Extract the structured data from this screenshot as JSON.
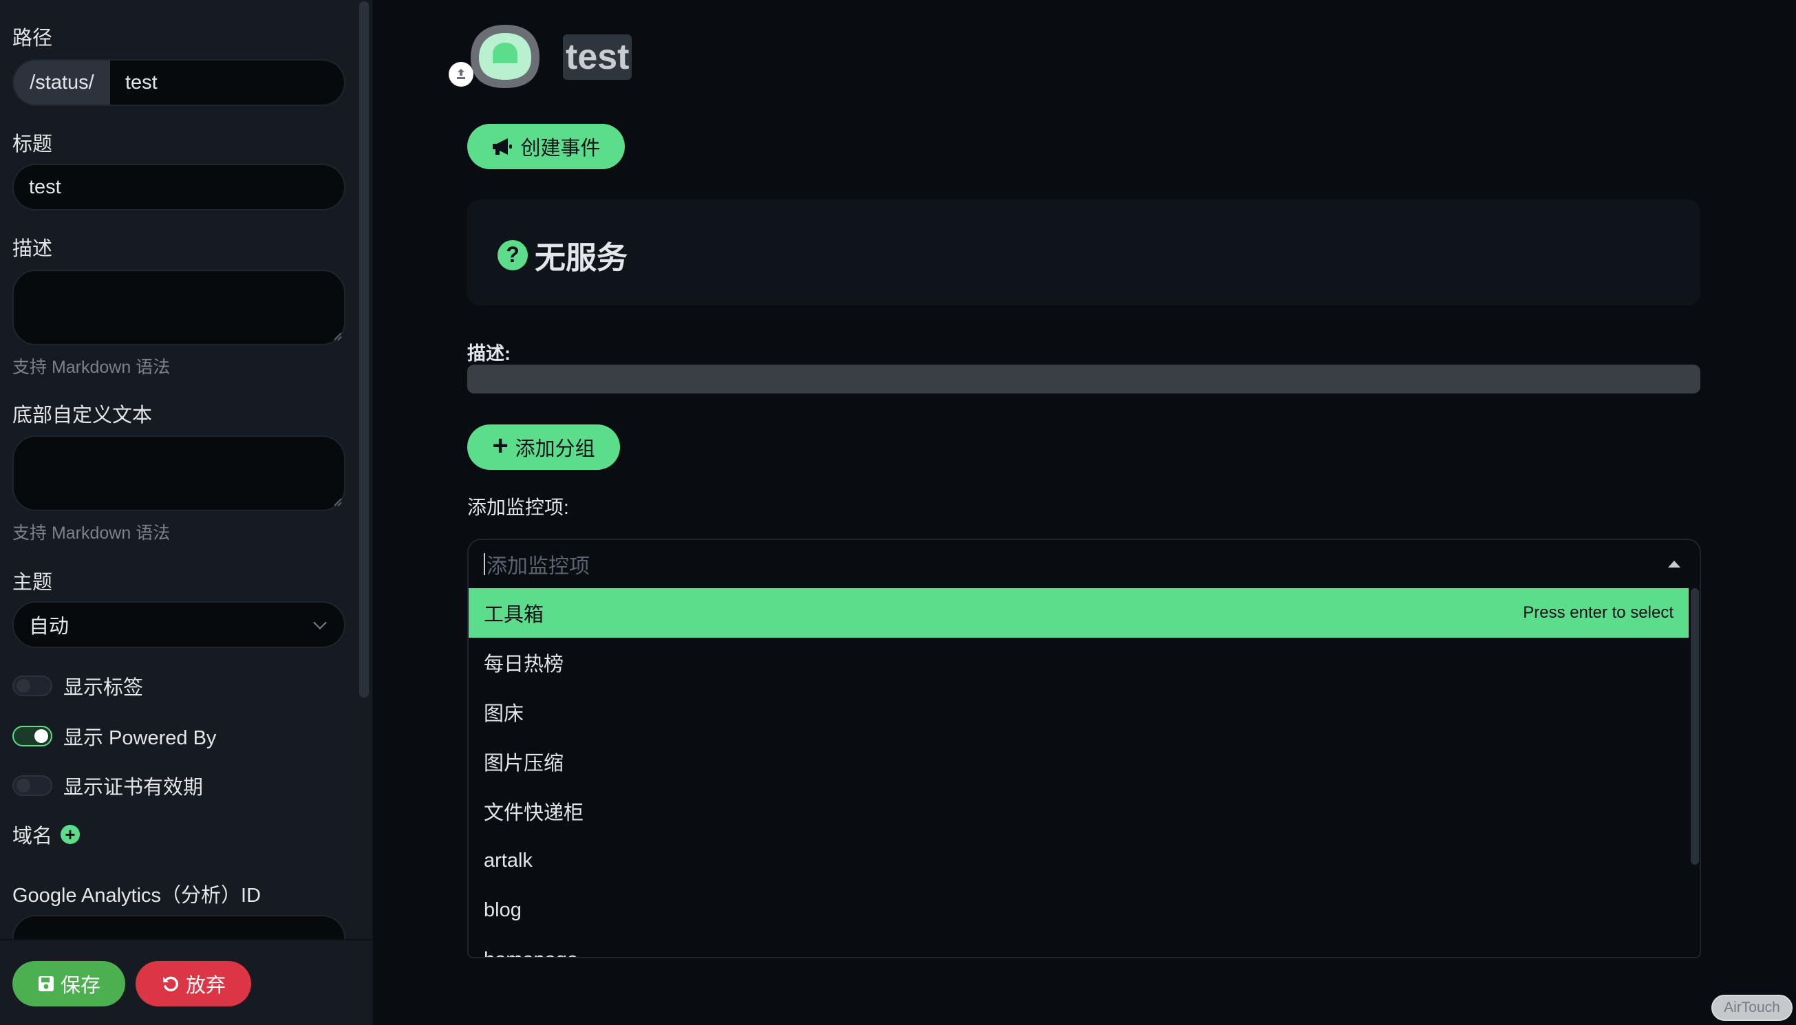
{
  "sidebar": {
    "path_label": "路径",
    "path_prefix": "/status/",
    "path_value": "test",
    "title_label": "标题",
    "title_value": "test",
    "description_label": "描述",
    "description_hint": "支持 Markdown 语法",
    "footer_label": "底部自定义文本",
    "footer_hint": "支持 Markdown 语法",
    "theme_label": "主题",
    "theme_value": "自动",
    "toggles": [
      {
        "label": "显示标签",
        "on": false
      },
      {
        "label": "显示 Powered By",
        "on": true
      },
      {
        "label": "显示证书有效期",
        "on": false
      }
    ],
    "domain_label": "域名",
    "ga_label": "Google Analytics（分析）ID",
    "save_label": "保存",
    "discard_label": "放弃"
  },
  "main": {
    "page_title": "test",
    "create_event_label": "创建事件",
    "status_title": "无服务",
    "description_label": "描述:",
    "add_group_label": "添加分组",
    "add_monitor_label": "添加监控项:",
    "monitor_placeholder": "添加监控项",
    "options": [
      "工具箱",
      "每日热榜",
      "图床",
      "图片压缩",
      "文件快递柜",
      "artalk",
      "blog",
      "homepage"
    ],
    "select_hint": "Press enter to select"
  },
  "overlay": {
    "airtouch": "AirTouch"
  },
  "colors": {
    "accent": "#5cdd8b",
    "danger": "#dc3545",
    "save": "#4caf50",
    "background": "#090c10",
    "sidebar": "#161b22"
  }
}
